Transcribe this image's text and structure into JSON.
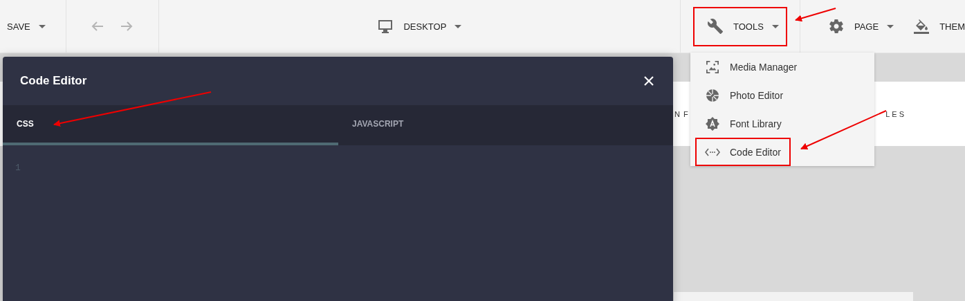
{
  "toolbar": {
    "save": {
      "label": "SAVE"
    },
    "device": {
      "label": "DESKTOP"
    },
    "tools": {
      "label": "TOOLS",
      "expanded": true
    },
    "page": {
      "label": "PAGE"
    },
    "theme": {
      "label": "THEM"
    }
  },
  "background_texts": [
    "N F",
    "LES"
  ],
  "tools_menu": [
    {
      "label": "Media Manager",
      "selected": false
    },
    {
      "label": "Photo Editor",
      "selected": false
    },
    {
      "label": "Font Library",
      "selected": false
    },
    {
      "label": "Code Editor",
      "selected": true
    }
  ],
  "code_editor": {
    "title": "Code Editor",
    "tabs": [
      {
        "label": "CSS",
        "selected": true
      },
      {
        "label": "JAVASCRIPT",
        "selected": false
      }
    ],
    "line_numbers": [
      "1"
    ]
  }
}
